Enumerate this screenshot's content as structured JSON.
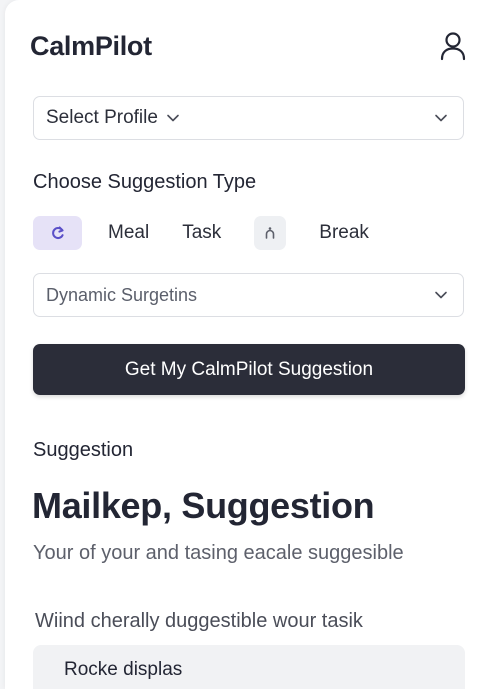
{
  "app": {
    "title": "CalmPilot",
    "user_icon": "user-icon"
  },
  "profile_select": {
    "value": "Select Profile",
    "inline_icon": "chevron-down-icon",
    "trailing_icon": "chevron-down-icon"
  },
  "suggestion_type": {
    "title": "Choose Suggestion Type",
    "options": [
      {
        "kind": "icon",
        "icon": "refresh-icon",
        "selected": true
      },
      {
        "kind": "label",
        "label": "Meal"
      },
      {
        "kind": "label",
        "label": "Task"
      },
      {
        "kind": "icon",
        "icon": "break-icon",
        "selected": false
      },
      {
        "kind": "label",
        "label": "Break"
      }
    ]
  },
  "dynamic_select": {
    "value": "Dynamic Surgetins",
    "trailing_icon": "chevron-down-icon"
  },
  "cta": {
    "label": "Get My CalmPilot Suggestion"
  },
  "suggestion": {
    "section_label": "Suggestion",
    "heading": "Mailkep, Suggestion",
    "subtitle": "Your of your and tasing eacale suggesible",
    "line": "Wiind cherally duggestible wour tasik",
    "result": "Rocke displas"
  },
  "colors": {
    "accent_chip": "#e6e2f7",
    "accent_icon": "#5a4fc8",
    "primary_button": "#2b2d39",
    "text": "#232634"
  }
}
